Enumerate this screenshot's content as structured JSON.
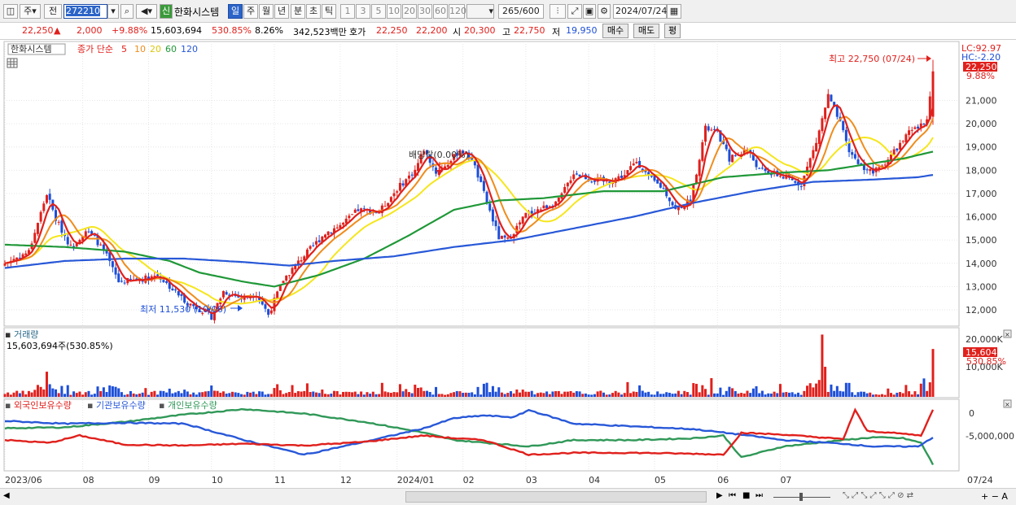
{
  "toolbar": {
    "market": "주",
    "prev": "전",
    "code": "272210",
    "name": "한화시스템",
    "credit": "신",
    "periods": [
      "일",
      "주",
      "월",
      "년",
      "분",
      "초",
      "틱"
    ],
    "intervals": [
      "1",
      "3",
      "5",
      "10",
      "20",
      "30",
      "60",
      "120"
    ],
    "count": "265",
    "count_max": "/600",
    "date": "2024/07/24"
  },
  "quote": {
    "price": "22,250",
    "arrow": "▲",
    "change": "2,000",
    "pct": "+9.88%",
    "volume": "15,603,694",
    "vol_ratio": "530.85%",
    "turnover": "8.26%",
    "amount": "342,523백만",
    "hoga_label": "호가",
    "ask": "22,250",
    "bid": "22,200",
    "open_label": "시",
    "open": "20,300",
    "high_label": "고",
    "high": "22,750",
    "low_label": "저",
    "low": "19,950",
    "buy": "매수",
    "sell": "매도",
    "eval": "평"
  },
  "colors": {
    "up": "#e0201c",
    "down": "#1c4ed8",
    "ma5": "#e0201c",
    "ma10": "#f08c1c",
    "ma20": "#f5e61c",
    "ma60": "#209838",
    "ma120": "#2858d8",
    "foreign": "#e0201c",
    "inst": "#2858d8",
    "indiv": "#309858"
  },
  "chart_data": [
    {
      "type": "candlestick",
      "legend_name": "한화시스템",
      "ma_label": "종가 단순",
      "ma_periods": [
        "5",
        "10",
        "20",
        "60",
        "120"
      ],
      "ylim": [
        11300,
        23500
      ],
      "yticks": [
        12000,
        13000,
        14000,
        15000,
        16000,
        17000,
        18000,
        19000,
        20000,
        21000
      ],
      "ytick_labels": [
        "12,000",
        "13,000",
        "14,000",
        "15,000",
        "16,000",
        "17,000",
        "18,000",
        "19,000",
        "20,000",
        "21,000"
      ],
      "lc": "LC:92.97",
      "hc": "HC:-2.20",
      "last_label": "22,250",
      "last_pct": "9.88%",
      "annotations": {
        "high": "최고 22,750 (07/24)",
        "low": "최저 11,530 (10/06)",
        "dividend": "배당락(0.00%)"
      },
      "x_labels": [
        "2023/06",
        "08",
        "09",
        "10",
        "11",
        "12",
        "2024/01",
        "02",
        "03",
        "04",
        "05",
        "06",
        "07"
      ],
      "x_last": "07/24",
      "anchors": [
        [
          0,
          14000
        ],
        [
          8,
          14500
        ],
        [
          14,
          17000
        ],
        [
          17,
          15900
        ],
        [
          22,
          14700
        ],
        [
          27,
          15400
        ],
        [
          30,
          15100
        ],
        [
          34,
          14300
        ],
        [
          38,
          13200
        ],
        [
          45,
          13300
        ],
        [
          51,
          13500
        ],
        [
          55,
          13000
        ],
        [
          61,
          12300
        ],
        [
          67,
          11900
        ],
        [
          69,
          11700
        ],
        [
          73,
          12800
        ],
        [
          79,
          12500
        ],
        [
          84,
          12700
        ],
        [
          88,
          11800
        ],
        [
          93,
          13300
        ],
        [
          99,
          14200
        ],
        [
          107,
          15300
        ],
        [
          113,
          15700
        ],
        [
          118,
          16300
        ],
        [
          125,
          16200
        ],
        [
          131,
          17200
        ],
        [
          137,
          18000
        ],
        [
          140,
          18900
        ],
        [
          144,
          17900
        ],
        [
          149,
          18400
        ],
        [
          152,
          18900
        ],
        [
          156,
          18500
        ],
        [
          160,
          17000
        ],
        [
          165,
          15100
        ],
        [
          168,
          15000
        ],
        [
          174,
          16100
        ],
        [
          180,
          16400
        ],
        [
          185,
          16700
        ],
        [
          190,
          17900
        ],
        [
          196,
          17600
        ],
        [
          201,
          17500
        ],
        [
          207,
          17800
        ],
        [
          211,
          18400
        ],
        [
          215,
          17700
        ],
        [
          220,
          17200
        ],
        [
          224,
          16300
        ],
        [
          229,
          16700
        ],
        [
          234,
          19800
        ],
        [
          238,
          19600
        ],
        [
          242,
          18500
        ],
        [
          248,
          18900
        ],
        [
          252,
          18000
        ],
        [
          258,
          17800
        ],
        [
          262,
          17600
        ],
        [
          266,
          17400
        ],
        [
          271,
          19200
        ],
        [
          275,
          21200
        ],
        [
          279,
          20000
        ],
        [
          282,
          18800
        ],
        [
          286,
          18200
        ],
        [
          290,
          17900
        ],
        [
          293,
          18200
        ],
        [
          297,
          18800
        ],
        [
          302,
          19600
        ],
        [
          306,
          19900
        ],
        [
          308,
          20300
        ],
        [
          310,
          22250
        ]
      ],
      "ma60_anchors": [
        [
          0,
          14800
        ],
        [
          20,
          14700
        ],
        [
          40,
          14500
        ],
        [
          55,
          14100
        ],
        [
          65,
          13600
        ],
        [
          80,
          13200
        ],
        [
          90,
          13000
        ],
        [
          105,
          13500
        ],
        [
          120,
          14200
        ],
        [
          135,
          15200
        ],
        [
          150,
          16300
        ],
        [
          165,
          16700
        ],
        [
          180,
          16800
        ],
        [
          200,
          17100
        ],
        [
          220,
          17100
        ],
        [
          240,
          17700
        ],
        [
          260,
          17900
        ],
        [
          275,
          18000
        ],
        [
          290,
          18300
        ],
        [
          300,
          18500
        ],
        [
          310,
          18800
        ]
      ],
      "ma120_anchors": [
        [
          0,
          13800
        ],
        [
          20,
          14100
        ],
        [
          40,
          14200
        ],
        [
          60,
          14200
        ],
        [
          80,
          14050
        ],
        [
          95,
          13900
        ],
        [
          110,
          14100
        ],
        [
          130,
          14300
        ],
        [
          150,
          14700
        ],
        [
          170,
          15000
        ],
        [
          190,
          15500
        ],
        [
          210,
          16000
        ],
        [
          230,
          16600
        ],
        [
          250,
          17100
        ],
        [
          270,
          17500
        ],
        [
          290,
          17600
        ],
        [
          305,
          17700
        ],
        [
          310,
          17800
        ]
      ]
    },
    {
      "type": "bar",
      "title": "거래량",
      "value_label": "15,603,694주(530.85%)",
      "ylim": [
        0,
        22000000
      ],
      "ytick_labels": [
        "10,000K",
        "20,000K"
      ],
      "last_label": "15,604K",
      "last_pct": "530.85%"
    },
    {
      "type": "line",
      "series_names": [
        "외국인보유수량",
        "기관보유수량",
        "개인보유수량"
      ],
      "ylim": [
        -6500000,
        1000000
      ],
      "ytick_labels": [
        "0",
        "-5,000,000"
      ],
      "foreign": [
        [
          0,
          -3300000
        ],
        [
          15,
          -3600000
        ],
        [
          25,
          -2800000
        ],
        [
          40,
          -3800000
        ],
        [
          60,
          -3900000
        ],
        [
          80,
          -3700000
        ],
        [
          100,
          -3900000
        ],
        [
          120,
          -3500000
        ],
        [
          140,
          -2800000
        ],
        [
          150,
          -3100000
        ],
        [
          160,
          -3300000
        ],
        [
          175,
          -4900000
        ],
        [
          190,
          -4700000
        ],
        [
          210,
          -4700000
        ],
        [
          230,
          -4800000
        ],
        [
          240,
          -4900000
        ],
        [
          246,
          -2500000
        ],
        [
          260,
          -2700000
        ],
        [
          280,
          -3200000
        ],
        [
          284,
          0
        ],
        [
          288,
          -2300000
        ],
        [
          300,
          -2600000
        ],
        [
          306,
          -2800000
        ],
        [
          310,
          0
        ]
      ],
      "inst": [
        [
          0,
          -1200000
        ],
        [
          20,
          -1500000
        ],
        [
          40,
          -1400000
        ],
        [
          60,
          -1500000
        ],
        [
          80,
          -3300000
        ],
        [
          100,
          -4900000
        ],
        [
          120,
          -3500000
        ],
        [
          140,
          -2000000
        ],
        [
          150,
          -900000
        ],
        [
          160,
          -600000
        ],
        [
          170,
          -800000
        ],
        [
          175,
          0
        ],
        [
          190,
          -1500000
        ],
        [
          210,
          -1800000
        ],
        [
          230,
          -2100000
        ],
        [
          246,
          -2700000
        ],
        [
          260,
          -3300000
        ],
        [
          280,
          -3700000
        ],
        [
          290,
          -4000000
        ],
        [
          305,
          -4000000
        ],
        [
          310,
          -3000000
        ]
      ],
      "indiv": [
        [
          0,
          -2000000
        ],
        [
          20,
          -1900000
        ],
        [
          40,
          -1300000
        ],
        [
          60,
          -500000
        ],
        [
          80,
          100000
        ],
        [
          100,
          -400000
        ],
        [
          120,
          -1300000
        ],
        [
          140,
          -2500000
        ],
        [
          150,
          -3300000
        ],
        [
          175,
          -4000000
        ],
        [
          190,
          -3300000
        ],
        [
          210,
          -3300000
        ],
        [
          230,
          -3100000
        ],
        [
          240,
          -2800000
        ],
        [
          246,
          -5200000
        ],
        [
          260,
          -4000000
        ],
        [
          280,
          -3300000
        ],
        [
          290,
          -3000000
        ],
        [
          300,
          -3100000
        ],
        [
          306,
          -3600000
        ],
        [
          310,
          -6000000
        ]
      ]
    }
  ],
  "bottom": {
    "zoom": "+ − A"
  }
}
